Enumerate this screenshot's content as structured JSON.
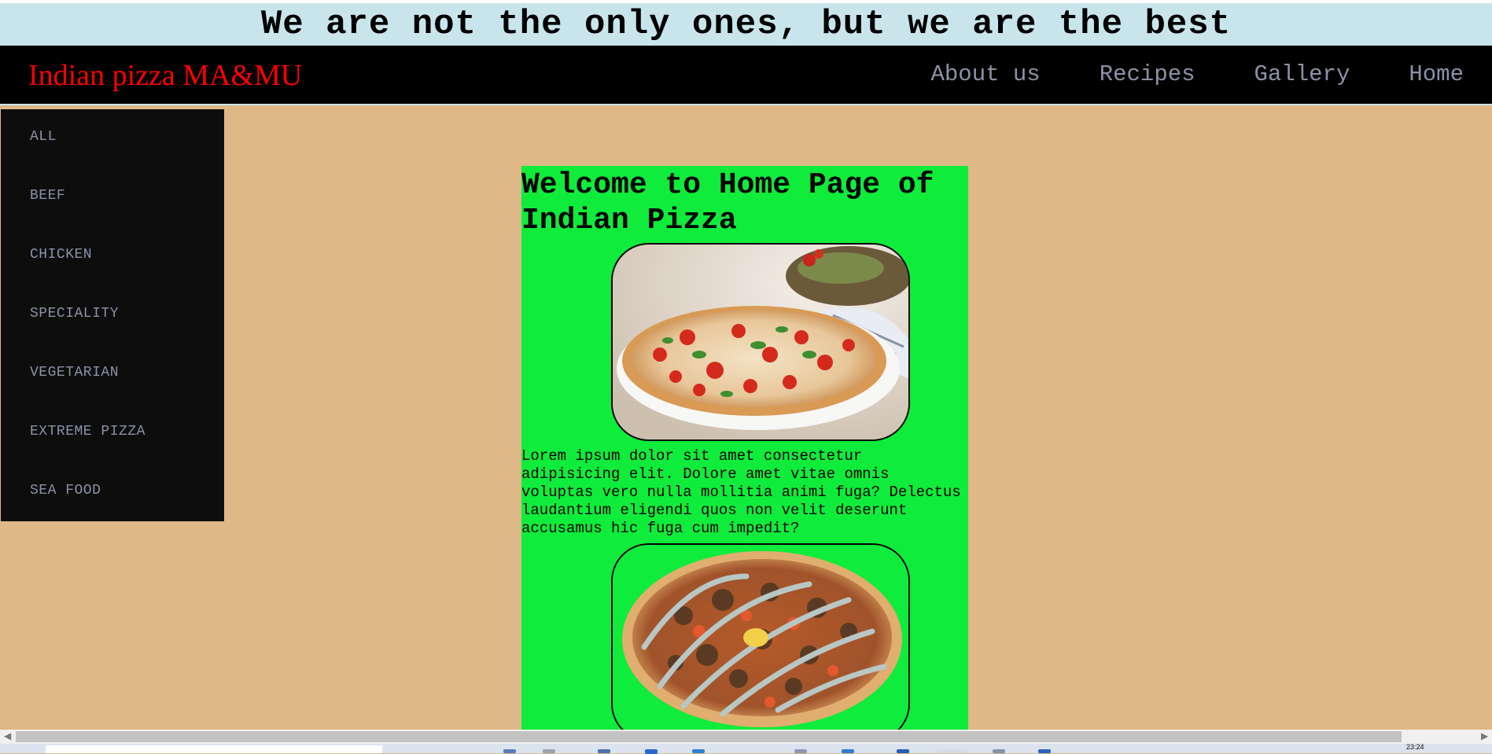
{
  "banner": {
    "text": "We are not the only ones, but we are the best"
  },
  "nav": {
    "brand": "Indian pizza MA&MU",
    "links": [
      "About us",
      "Recipes",
      "Gallery",
      "Home"
    ]
  },
  "sidebar": {
    "items": [
      "ALL",
      "BEEF",
      "CHICKEN",
      "SPECIALITY",
      "VEGETARIAN",
      "EXTREME PIZZA",
      "SEA FOOD"
    ]
  },
  "main": {
    "heading": "Welcome to Home Page of Indian Pizza",
    "paragraph": "Lorem ipsum dolor sit amet consectetur adipisicing elit. Dolore amet vitae omnis voluptas vero nulla mollitia animi fuga? Delectus laudantium eligendi quos non velit deserunt accusamus hic fuga cum impedit?"
  },
  "colors": {
    "banner_bg": "#c9e5ec",
    "nav_bg": "#000000",
    "brand": "#ff0000",
    "nav_link": "#8c91a8",
    "page_bg": "#deb887",
    "sidebar_bg": "#0d0d0d",
    "main_bg": "#0fec3b"
  },
  "icons": [
    "margherita-pizza-image",
    "kebab-pizza-image",
    "scroll-left-icon",
    "scroll-right-icon"
  ],
  "taskbar": {
    "clock": "23:24"
  }
}
